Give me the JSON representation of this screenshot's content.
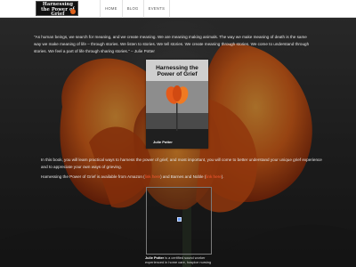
{
  "header": {
    "logo_text": "Harnessing the Power of Grief",
    "nav": [
      "HOME",
      "BLOG",
      "EVENTS"
    ]
  },
  "quote": {
    "text": "\"As human beings, we search for meaning, and we create meaning. We are meaning making animals. The way we make meaning of death is the same way we make meaning of life – through stories. We listen to stories. We tell stories. We create meaning through stories. We come to understand through stories. We feel a part of life through sharing stories.\" – Julie Potter"
  },
  "book": {
    "title": "Harnessing the Power of Grief",
    "author": "Julie Potter"
  },
  "body": {
    "paragraph_1": "In this book, you will learn practical ways to harness the power of grief, and most important, you will come to better understand your unique grief experience and to appreciate your own ways of grieving.",
    "paragraph_2_prefix": "Harnessing the Power of Grief is available from Amazon (",
    "link_1": "link here",
    "paragraph_2_middle": ") and Barnes and Noble (",
    "link_2": "link here",
    "paragraph_2_suffix": ")."
  },
  "bio": {
    "name": "Julie Potter",
    "text": " is a certified sound worker experienced in home care, hospice nursing"
  },
  "colors": {
    "accent": "#ff5a33",
    "flower": "#e0611a",
    "header_bg": "#ffffff"
  }
}
